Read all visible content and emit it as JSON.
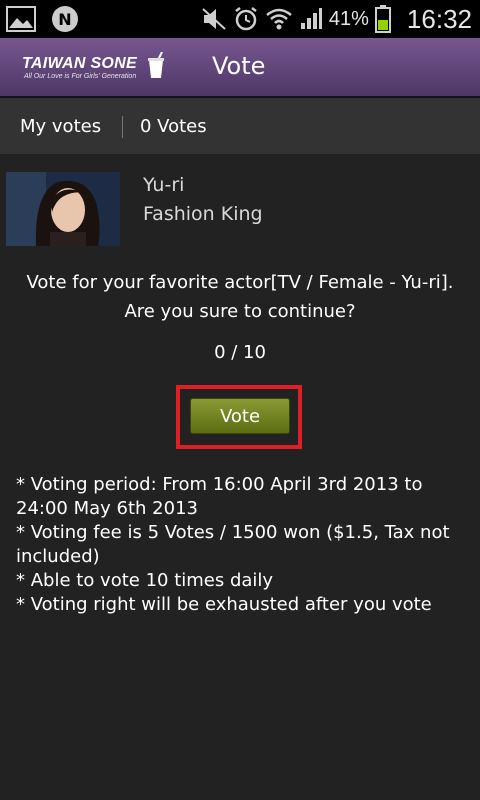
{
  "status_bar": {
    "battery_percent": "41%",
    "time": "16:32",
    "icons": [
      "gallery-icon",
      "n-notification-icon",
      "mute-icon",
      "alarm-icon",
      "wifi-icon",
      "signal-icon",
      "battery-icon"
    ]
  },
  "header": {
    "logo_text": "TAIWAN SONE",
    "logo_tagline": "All Our Love is For Girls' Generation",
    "title": "Vote"
  },
  "votes_bar": {
    "label": "My votes",
    "count": "0 Votes"
  },
  "actor": {
    "name": "Yu-ri",
    "show": "Fashion King"
  },
  "confirm": {
    "line1": "Vote for your favorite actor[TV / Female - Yu-ri].",
    "line2": "Are you sure to continue?"
  },
  "counter": "0 / 10",
  "vote_button": "Vote",
  "info": [
    "* Voting period: From 16:00 April 3rd 2013 to 24:00 May 6th 2013",
    "* Voting fee is 5 Votes / 1500 won ($1.5, Tax not included)",
    "* Able to vote 10 times daily",
    "* Voting right will be exhausted after you vote"
  ],
  "colors": {
    "header_purple": "#5f4479",
    "button_green": "#6f8023",
    "highlight_red": "#dd1f26"
  }
}
